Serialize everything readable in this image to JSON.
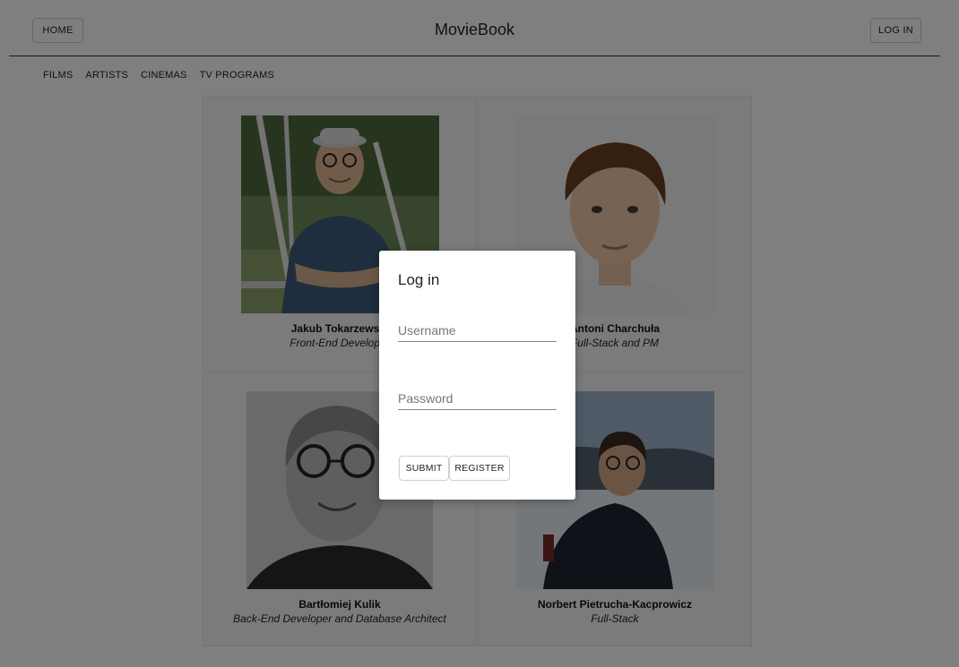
{
  "header": {
    "home_label": "HOME",
    "brand": "MovieBook",
    "login_label": "LOG IN"
  },
  "nav": {
    "items": [
      "FILMS",
      "ARTISTS",
      "CINEMAS",
      "TV PROGRAMS"
    ]
  },
  "team": [
    {
      "name": "Jakub Tokarzewski",
      "role": "Front-End Developer"
    },
    {
      "name": "Antoni Charchuła",
      "role": "Full-Stack and PM"
    },
    {
      "name": "Bartłomiej Kulik",
      "role": "Back-End Developer and Database Architect"
    },
    {
      "name": "Norbert Pietrucha-Kacprowicz",
      "role": "Full-Stack"
    }
  ],
  "login_modal": {
    "title": "Log in",
    "username_placeholder": "Username",
    "password_placeholder": "Password",
    "submit_label": "SUBMIT",
    "register_label": "REGISTER"
  },
  "colors": {
    "overlay": "#000000",
    "modal_bg": "#ffffff",
    "card_bg": "#f7f7f7"
  }
}
